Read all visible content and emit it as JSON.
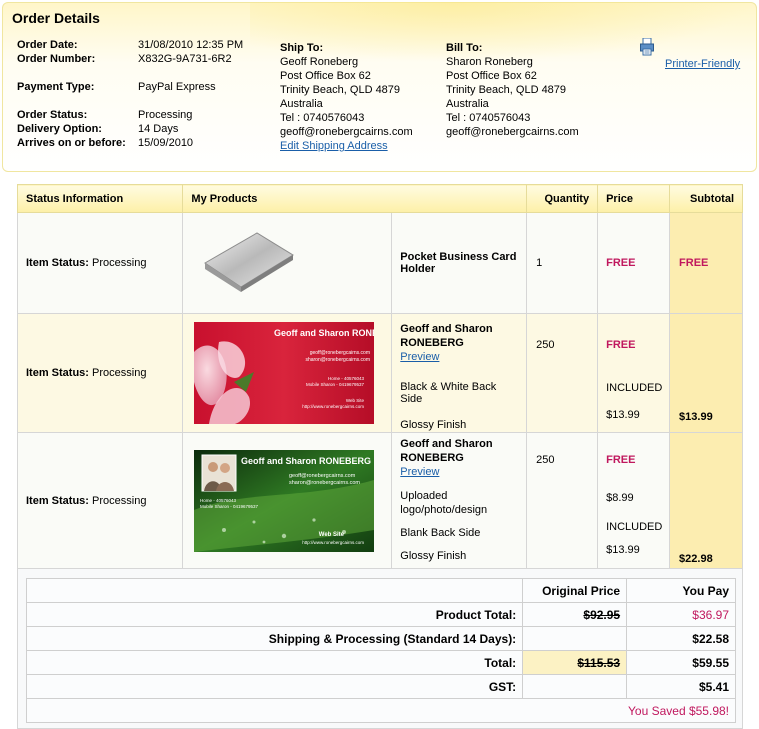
{
  "order": {
    "title": "Order Details",
    "date_label": "Order Date:",
    "date": "31/08/2010 12:35 PM",
    "number_label": "Order Number:",
    "number": "X832G-9A731-6R2",
    "payment_label": "Payment Type:",
    "payment": "PayPal Express",
    "status_label": "Order Status:",
    "status": "Processing",
    "delivery_label": "Delivery Option:",
    "delivery": "14 Days",
    "arrives_label": "Arrives on or before:",
    "arrives": "15/09/2010"
  },
  "ship_to": {
    "heading": "Ship To:",
    "lines": [
      "Geoff Roneberg",
      "Post Office Box 62",
      "Trinity Beach, QLD 4879",
      "Australia",
      "Tel : 0740576043",
      "geoff@ronebergcairns.com"
    ],
    "edit_link": "Edit Shipping Address"
  },
  "bill_to": {
    "heading": "Bill To:",
    "lines": [
      "Sharon Roneberg",
      "Post Office Box 62",
      "Trinity Beach, QLD 4879",
      "Australia",
      "Tel : 0740576043",
      "geoff@ronebergcairns.com"
    ]
  },
  "printer": {
    "label": "Printer-Friendly",
    "icon": "printer-icon"
  },
  "table": {
    "headers": [
      "Status Information",
      "My Products",
      "Quantity",
      "Price",
      "Subtotal"
    ],
    "status_label": "Item Status:",
    "rows": [
      {
        "status": "Processing",
        "product": "Pocket Business Card Holder",
        "quantity": "1",
        "price": "FREE",
        "subtotal": "FREE"
      },
      {
        "status": "Processing",
        "product": "Geoff and Sharon RONEBERG",
        "preview": "Preview",
        "options": [
          "Black & White Back Side",
          "Glossy Finish"
        ],
        "quantity": "250",
        "price": "FREE",
        "option_prices": [
          "INCLUDED",
          "$13.99"
        ],
        "subtotal": "$13.99",
        "card": {
          "name": "Geoff and Sharon RONEBERG",
          "emails": [
            "geoff@ronebergcairns.com",
            "sharon@ronebergcairns.com"
          ],
          "home": "Home - 40576043",
          "mobile": "Mobile Sharon - 0419679537",
          "web_label": "Web Site",
          "web": "http://www.ronebergcairns.com"
        }
      },
      {
        "status": "Processing",
        "product": "Geoff and Sharon RONEBERG",
        "preview": "Preview",
        "options": [
          "Uploaded logo/photo/design",
          "Blank Back Side",
          "Glossy Finish"
        ],
        "quantity": "250",
        "price": "FREE",
        "option_prices": [
          "$8.99",
          "INCLUDED",
          "$13.99"
        ],
        "subtotal": "$22.98",
        "card": {
          "name": "Geoff and Sharon RONEBERG",
          "emails": [
            "geoff@ronebergcairns.com",
            "sharon@ronebergcairns.com"
          ],
          "home": "Home - 40576043",
          "mobile": "Mobile Sharon - 0419679537",
          "web_label": "Web Site",
          "web": "http://www.ronebergcairns.com"
        }
      }
    ]
  },
  "summary": {
    "col_original": "Original Price",
    "col_pay": "You Pay",
    "product_total_label": "Product Total:",
    "product_total_orig": "$92.95",
    "product_total_pay": "$36.97",
    "shipping_label": "Shipping & Processing (Standard 14 Days):",
    "shipping_pay": "$22.58",
    "total_label": "Total:",
    "total_orig": "$115.53",
    "total_pay": "$59.55",
    "gst_label": "GST:",
    "gst_pay": "$5.41",
    "saved": "You Saved $55.98!"
  },
  "colors": {
    "accent": "#c0185e",
    "link": "#1a5ea8",
    "cream": "#fcedb0"
  }
}
